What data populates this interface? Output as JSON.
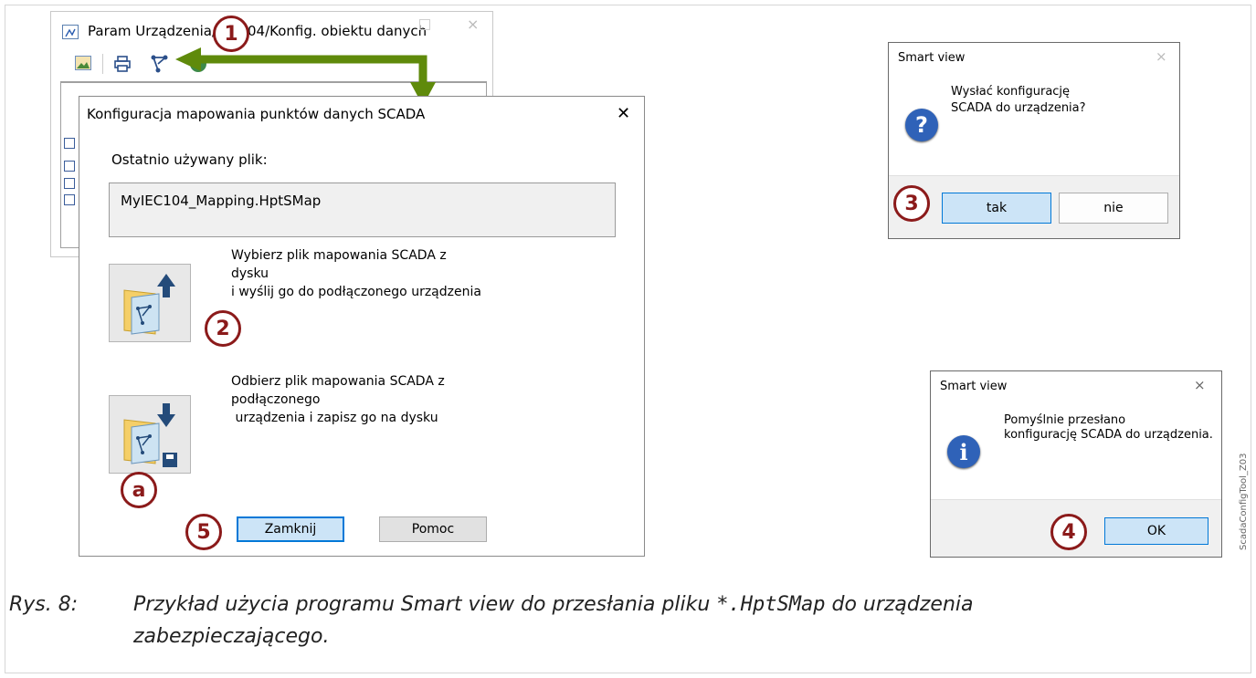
{
  "bg_window": {
    "title": "Param Urządzenia/IEC104/Konfig. obiektu danych",
    "close_glyph": "×",
    "toolbar_icons": [
      "image-icon",
      "print-icon",
      "scada-map-icon",
      "globe-icon"
    ]
  },
  "main_dialog": {
    "title": "Konfiguracja mapowania punktów danych SCADA",
    "close_glyph": "✕",
    "recent_label": "Ostatnio używany plik:",
    "recent_file": "MyIEC104_Mapping.HptSMap",
    "upload_text": [
      "Wybierz plik mapowania SCADA z",
      "dysku",
      "i wyślij go do podłączonego urządzenia"
    ],
    "download_text": [
      "Odbierz plik mapowania SCADA z",
      "podłączonego",
      " urządzenia i zapisz go na dysku"
    ],
    "close_button": "Zamknij",
    "help_button": "Pomoc"
  },
  "confirm_dialog": {
    "title": "Smart view",
    "close_glyph": "×",
    "message": [
      "Wysłać konfigurację",
      "SCADA do urządzenia?"
    ],
    "yes_button": "tak",
    "no_button": "nie",
    "icon": "question-icon"
  },
  "success_dialog": {
    "title": "Smart view",
    "close_glyph": "×",
    "message": [
      "Pomyślnie przesłano",
      "konfigurację SCADA do urządzenia."
    ],
    "ok_button": "OK",
    "icon": "info-icon"
  },
  "markers": {
    "m1": "1",
    "m2": "2",
    "m3": "3",
    "m4": "4",
    "m5": "5",
    "ma": "a"
  },
  "side_label": "ScadaConfigTool_Z03",
  "caption": {
    "prefix": "Rys. 8:",
    "line1_a": "Przykład użycia programu Smart view do przesłania pliku ",
    "line1_code": "*.HptSMap",
    "line1_b": " do urządzenia",
    "line2": "zabezpieczającego."
  },
  "colors": {
    "marker": "#8b1a1a",
    "arrow": "#5f8a0b",
    "accent": "#0078d7"
  }
}
